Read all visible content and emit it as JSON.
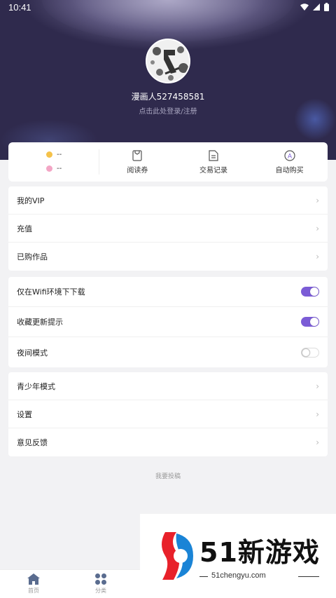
{
  "status_bar": {
    "time": "10:41"
  },
  "profile": {
    "username": "漫画人527458581",
    "login_hint": "点击此处登录/注册"
  },
  "stats": {
    "coin1_value": "--",
    "coin2_value": "--",
    "items": [
      {
        "label": "阅读券",
        "icon": "ticket-icon"
      },
      {
        "label": "交易记录",
        "icon": "document-icon"
      },
      {
        "label": "自动购买",
        "icon": "auto-buy-icon"
      }
    ]
  },
  "menu_group_1": {
    "items": [
      {
        "label": "我的VIP"
      },
      {
        "label": "充值"
      },
      {
        "label": "已购作品"
      }
    ]
  },
  "settings_group": {
    "items": [
      {
        "label": "仅在Wifi环境下下载",
        "enabled": true
      },
      {
        "label": "收藏更新提示",
        "enabled": true
      },
      {
        "label": "夜间模式",
        "enabled": false
      }
    ]
  },
  "menu_group_2": {
    "items": [
      {
        "label": "青少年模式"
      },
      {
        "label": "设置"
      },
      {
        "label": "意见反馈"
      }
    ]
  },
  "submit_link": "我要投稿",
  "bottom_nav": [
    {
      "label": "首页",
      "icon": "home-icon"
    },
    {
      "label": "分类",
      "icon": "grid-icon"
    }
  ],
  "watermark": {
    "text": "51新游戏",
    "url": "51chengyu.com"
  },
  "colors": {
    "accent": "#7b5cd6",
    "header_bg": "#2b2547"
  }
}
